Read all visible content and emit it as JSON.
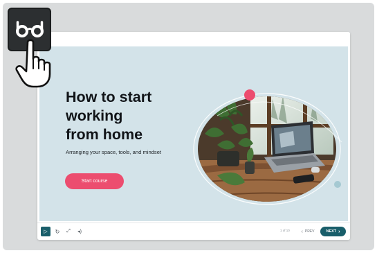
{
  "slide": {
    "title": "How to start\nworking\nfrom home",
    "subtitle": "Arranging your space, tools, and mindset",
    "start_button": "Start course"
  },
  "controls": {
    "page_count": "1 of 10",
    "prev_label": "PREV",
    "next_label": "NEXT"
  },
  "icons": {
    "badge": "glasses-icon",
    "cursor": "hand-pointer-icon",
    "play": "play-icon",
    "replay": "replay-icon",
    "fullscreen": "fullscreen-icon",
    "volume": "volume-icon",
    "prev": "chevron-left-icon",
    "next": "chevron-right-icon"
  },
  "colors": {
    "slide_bg": "#d3e3e9",
    "accent_pink": "#ec4d6f",
    "accent_teal": "#195e6a",
    "badge_bg": "#2c2f31"
  }
}
